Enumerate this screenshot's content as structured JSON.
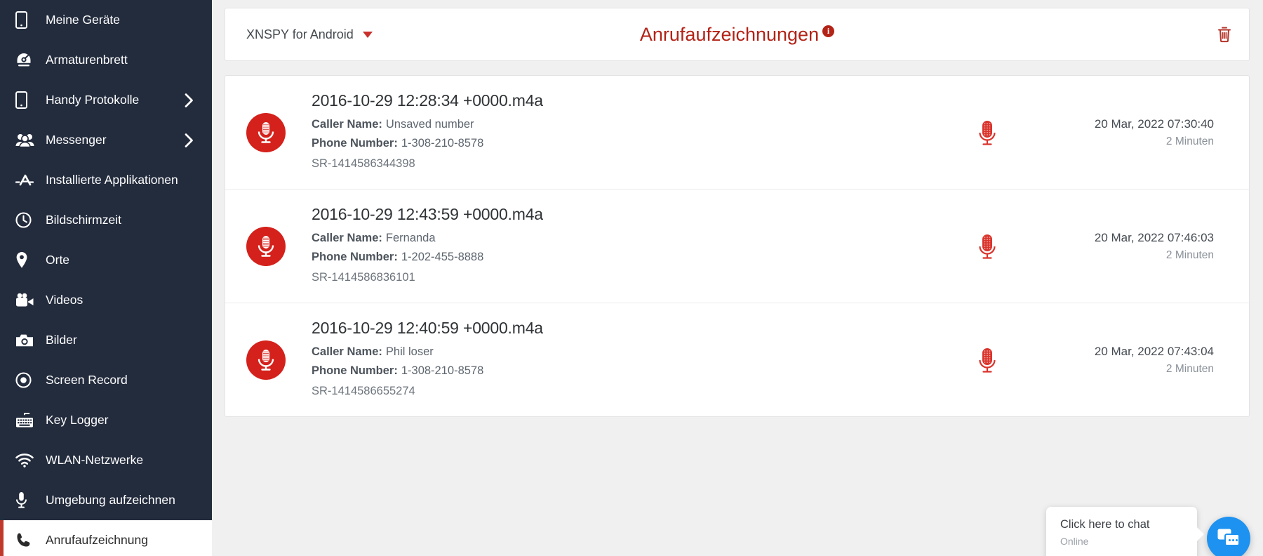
{
  "sidebar": {
    "items": [
      {
        "label": "Meine Geräte",
        "icon": "phone-icon",
        "chevron": false,
        "active": false
      },
      {
        "label": "Armaturenbrett",
        "icon": "dashboard-icon",
        "chevron": false,
        "active": false
      },
      {
        "label": "Handy Protokolle",
        "icon": "phone-icon",
        "chevron": true,
        "active": false
      },
      {
        "label": "Messenger",
        "icon": "users-icon",
        "chevron": true,
        "active": false
      },
      {
        "label": "Installierte Applikationen",
        "icon": "apps-icon",
        "chevron": false,
        "active": false
      },
      {
        "label": "Bildschirmzeit",
        "icon": "clock-icon",
        "chevron": false,
        "active": false
      },
      {
        "label": "Orte",
        "icon": "location-pin-icon",
        "chevron": false,
        "active": false
      },
      {
        "label": "Videos",
        "icon": "video-camera-icon",
        "chevron": false,
        "active": false
      },
      {
        "label": "Bilder",
        "icon": "camera-icon",
        "chevron": false,
        "active": false
      },
      {
        "label": "Screen Record",
        "icon": "record-dot-icon",
        "chevron": false,
        "active": false
      },
      {
        "label": "Key Logger",
        "icon": "keyboard-icon",
        "chevron": false,
        "active": false
      },
      {
        "label": "WLAN-Netzwerke",
        "icon": "wifi-icon",
        "chevron": false,
        "active": false
      },
      {
        "label": "Umgebung aufzeichnen",
        "icon": "microphone-icon",
        "chevron": false,
        "active": false
      },
      {
        "label": "Anrufaufzeichnung",
        "icon": "phone-call-icon",
        "chevron": false,
        "active": true
      }
    ]
  },
  "topbar": {
    "device_label": "XNSPY for Android",
    "page_title": "Anrufaufzeichnungen",
    "info_char": "i",
    "delete_name": "delete-all-button"
  },
  "recordings": [
    {
      "file": "2016-10-29 12:28:34 +0000.m4a",
      "caller_label": "Caller Name:",
      "caller_value": "Unsaved number",
      "phone_label": "Phone Number:",
      "phone_value": "1-308-210-8578",
      "sr": "SR-1414586344398",
      "date": "20 Mar, 2022 07:30:40",
      "duration": "2 Minuten"
    },
    {
      "file": "2016-10-29 12:43:59 +0000.m4a",
      "caller_label": "Caller Name:",
      "caller_value": "Fernanda",
      "phone_label": "Phone Number:",
      "phone_value": "1-202-455-8888",
      "sr": "SR-1414586836101",
      "date": "20 Mar, 2022 07:46:03",
      "duration": "2 Minuten"
    },
    {
      "file": "2016-10-29 12:40:59 +0000.m4a",
      "caller_label": "Caller Name:",
      "caller_value": "Phil loser",
      "phone_label": "Phone Number:",
      "phone_value": "1-308-210-8578",
      "sr": "SR-1414586655274",
      "date": "20 Mar, 2022 07:43:04",
      "duration": "2 Minuten"
    }
  ],
  "chat": {
    "title": "Click here to chat",
    "subtitle": "Online"
  },
  "colors": {
    "sidebar_bg": "#232c3d",
    "accent_red": "#c0392b",
    "title_red": "#b32317",
    "mic_red": "#d4211b",
    "page_bg": "#f0f0f0",
    "chat_blue": "#1e92f0"
  }
}
